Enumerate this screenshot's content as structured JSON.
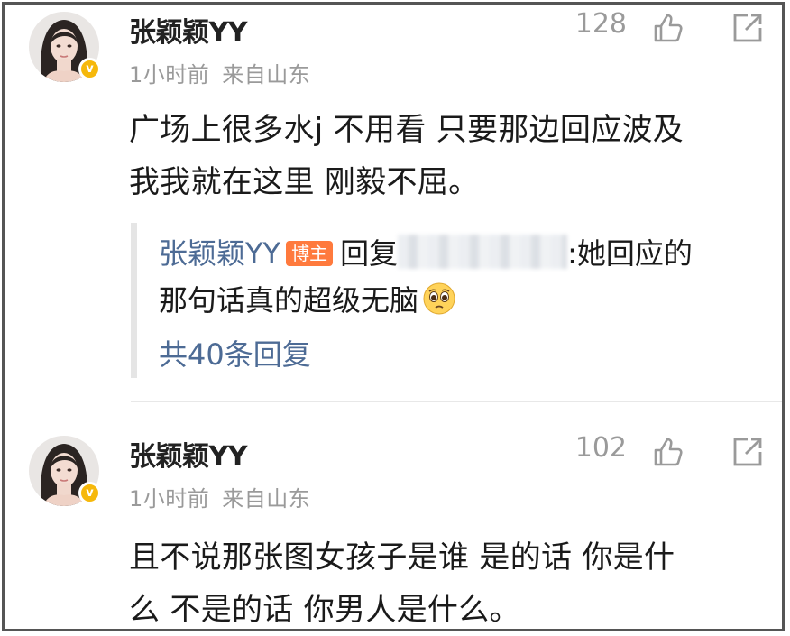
{
  "comments": [
    {
      "username": "张颖颖YY",
      "time": "1小时前",
      "location": "来自山东",
      "likes": "128",
      "text_line1": "广场上很多水j 不用看 只要那边回应波及",
      "text_line2": "我我就在这里 刚毅不屈。",
      "reply": {
        "username": "张颖颖YY",
        "badge": "博主",
        "reply_word": "回复",
        "text_line1_suffix": ":她回应的",
        "text_line2": "那句话真的超级无脑",
        "emoji": "pleading-face-icon",
        "count_label": "共40条回复"
      }
    },
    {
      "username": "张颖颖YY",
      "time": "1小时前",
      "location": "来自山东",
      "likes": "102",
      "text_line1": "且不说那张图女孩子是谁 是的话 你是什",
      "text_line2": "么 不是的话 你男人是什么。"
    }
  ],
  "colors": {
    "link_blue": "#4d6b95",
    "badge_orange": "#ff7a3d",
    "verified_gold": "#f6b80b",
    "meta_gray": "#9a9a9a"
  }
}
